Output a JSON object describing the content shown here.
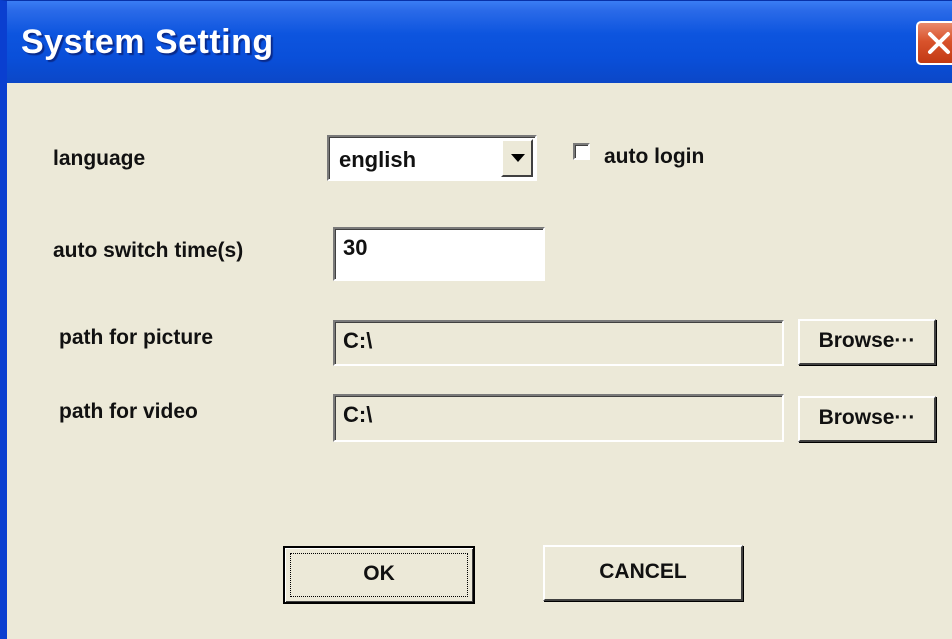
{
  "window": {
    "title": "System Setting"
  },
  "settings": {
    "language_label": "language",
    "language_value": "english",
    "auto_login_label": "auto login",
    "auto_login_checked": false,
    "auto_switch_label": "auto switch time(s)",
    "auto_switch_value": "30",
    "picture_path_label": "path for picture",
    "picture_path_value": "C:\\",
    "video_path_label": "path for video",
    "video_path_value": "C:\\",
    "browse_label": "Browse···"
  },
  "buttons": {
    "ok_label": "OK",
    "cancel_label": "CANCEL"
  },
  "colors": {
    "titlebar": "#0a4fd9",
    "face": "#ece9d8",
    "close": "#d9532c"
  },
  "icons": {
    "close": "close-icon",
    "dropdown": "chevron-down-icon"
  }
}
